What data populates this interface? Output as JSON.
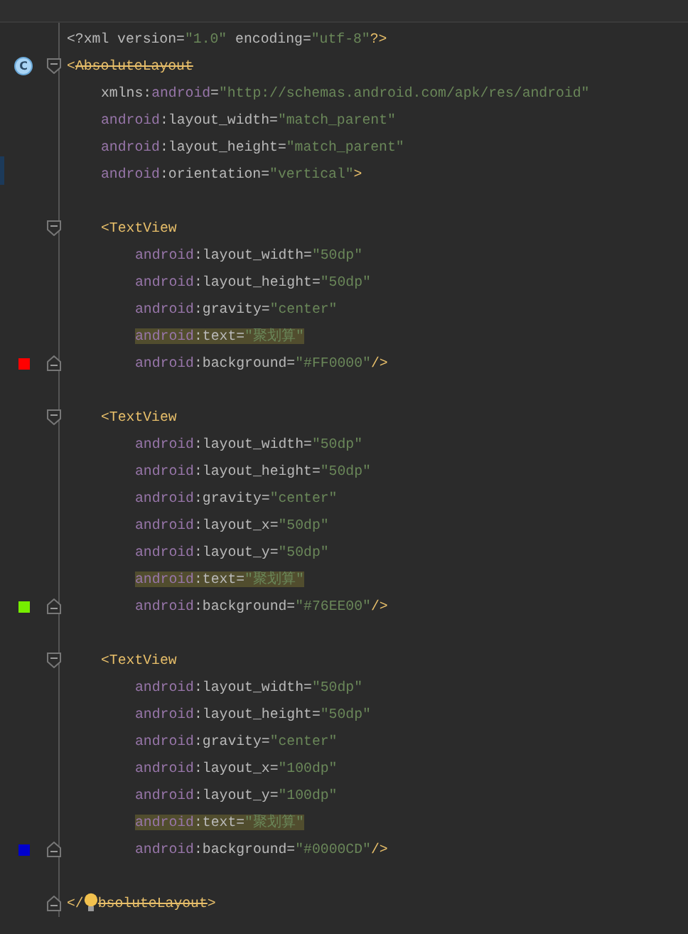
{
  "editor": {
    "lines": [
      {
        "kind": "code",
        "highlighted": false,
        "tokens": [
          {
            "kind": "plain",
            "text": "<?xml version="
          },
          {
            "kind": "value",
            "text": "\"1.0\""
          },
          {
            "kind": "plain",
            "text": " encoding="
          },
          {
            "kind": "value",
            "text": "\"utf-8\""
          },
          {
            "kind": "tag",
            "text": "?>"
          }
        ]
      },
      {
        "kind": "fold-start",
        "highlighted": false,
        "gutter_badge": "C",
        "tokens": [
          {
            "kind": "tag",
            "text": "<"
          },
          {
            "kind": "tag-deprecated",
            "text": "AbsoluteLayout"
          }
        ],
        "children": [
          {
            "kind": "code",
            "highlighted": false,
            "tokens": [
              {
                "kind": "plain",
                "text": "xmlns:"
              },
              {
                "kind": "ns",
                "text": "android"
              },
              {
                "kind": "plain",
                "text": "="
              },
              {
                "kind": "value",
                "text": "\"http://schemas.android.com/apk/res/android\""
              }
            ]
          },
          {
            "kind": "code",
            "highlighted": false,
            "tokens": [
              {
                "kind": "ns",
                "text": "android"
              },
              {
                "kind": "plain",
                "text": ":layout_width="
              },
              {
                "kind": "value",
                "text": "\"match_parent\""
              }
            ]
          },
          {
            "kind": "code",
            "highlighted": false,
            "tokens": [
              {
                "kind": "ns",
                "text": "android"
              },
              {
                "kind": "plain",
                "text": ":layout_height="
              },
              {
                "kind": "value",
                "text": "\"match_parent\""
              }
            ]
          },
          {
            "kind": "code",
            "highlighted": false,
            "tokens": [
              {
                "kind": "ns",
                "text": "android"
              },
              {
                "kind": "plain",
                "text": ":orientation="
              },
              {
                "kind": "value",
                "text": "\"vertical\""
              },
              {
                "kind": "tag",
                "text": ">"
              }
            ]
          },
          {
            "kind": "blank",
            "highlighted": false
          },
          {
            "kind": "fold-start",
            "highlighted": false,
            "tokens": [
              {
                "kind": "tag",
                "text": "<TextView"
              }
            ],
            "children": [
              {
                "kind": "code",
                "highlighted": false,
                "tokens": [
                  {
                    "kind": "ns",
                    "text": "android"
                  },
                  {
                    "kind": "plain",
                    "text": ":layout_width="
                  },
                  {
                    "kind": "value",
                    "text": "\"50dp\""
                  }
                ]
              },
              {
                "kind": "code",
                "highlighted": false,
                "tokens": [
                  {
                    "kind": "ns",
                    "text": "android"
                  },
                  {
                    "kind": "plain",
                    "text": ":layout_height="
                  },
                  {
                    "kind": "value",
                    "text": "\"50dp\""
                  }
                ]
              },
              {
                "kind": "code",
                "highlighted": false,
                "tokens": [
                  {
                    "kind": "ns",
                    "text": "android"
                  },
                  {
                    "kind": "plain",
                    "text": ":gravity="
                  },
                  {
                    "kind": "value",
                    "text": "\"center\""
                  }
                ]
              },
              {
                "kind": "code",
                "highlighted": true,
                "tokens": [
                  {
                    "kind": "ns",
                    "text": "android"
                  },
                  {
                    "kind": "plain",
                    "text": ":text="
                  },
                  {
                    "kind": "value",
                    "text": "\"聚划算\""
                  }
                ]
              },
              {
                "kind": "fold-end",
                "highlighted": false,
                "color": "#ff0000",
                "tokens": [
                  {
                    "kind": "ns",
                    "text": "android"
                  },
                  {
                    "kind": "plain",
                    "text": ":background="
                  },
                  {
                    "kind": "value",
                    "text": "\"#FF0000\""
                  },
                  {
                    "kind": "tag",
                    "text": "/>"
                  }
                ]
              }
            ]
          },
          {
            "kind": "blank",
            "highlighted": false
          },
          {
            "kind": "fold-start",
            "highlighted": false,
            "tokens": [
              {
                "kind": "tag",
                "text": "<TextView"
              }
            ],
            "children": [
              {
                "kind": "code",
                "highlighted": false,
                "tokens": [
                  {
                    "kind": "ns",
                    "text": "android"
                  },
                  {
                    "kind": "plain",
                    "text": ":layout_width="
                  },
                  {
                    "kind": "value",
                    "text": "\"50dp\""
                  }
                ]
              },
              {
                "kind": "code",
                "highlighted": false,
                "tokens": [
                  {
                    "kind": "ns",
                    "text": "android"
                  },
                  {
                    "kind": "plain",
                    "text": ":layout_height="
                  },
                  {
                    "kind": "value",
                    "text": "\"50dp\""
                  }
                ]
              },
              {
                "kind": "code",
                "highlighted": false,
                "tokens": [
                  {
                    "kind": "ns",
                    "text": "android"
                  },
                  {
                    "kind": "plain",
                    "text": ":gravity="
                  },
                  {
                    "kind": "value",
                    "text": "\"center\""
                  }
                ]
              },
              {
                "kind": "code",
                "highlighted": false,
                "tokens": [
                  {
                    "kind": "ns",
                    "text": "android"
                  },
                  {
                    "kind": "plain",
                    "text": ":layout_x="
                  },
                  {
                    "kind": "value",
                    "text": "\"50dp\""
                  }
                ]
              },
              {
                "kind": "code",
                "highlighted": false,
                "tokens": [
                  {
                    "kind": "ns",
                    "text": "android"
                  },
                  {
                    "kind": "plain",
                    "text": ":layout_y="
                  },
                  {
                    "kind": "value",
                    "text": "\"50dp\""
                  }
                ]
              },
              {
                "kind": "code",
                "highlighted": true,
                "tokens": [
                  {
                    "kind": "ns",
                    "text": "android"
                  },
                  {
                    "kind": "plain",
                    "text": ":text="
                  },
                  {
                    "kind": "value",
                    "text": "\"聚划算\""
                  }
                ]
              },
              {
                "kind": "fold-end",
                "highlighted": false,
                "color": "#76ee00",
                "tokens": [
                  {
                    "kind": "ns",
                    "text": "android"
                  },
                  {
                    "kind": "plain",
                    "text": ":background="
                  },
                  {
                    "kind": "value",
                    "text": "\"#76EE00\""
                  },
                  {
                    "kind": "tag",
                    "text": "/>"
                  }
                ]
              }
            ]
          },
          {
            "kind": "blank",
            "highlighted": false
          },
          {
            "kind": "fold-start",
            "highlighted": false,
            "tokens": [
              {
                "kind": "tag",
                "text": "<TextView"
              }
            ],
            "children": [
              {
                "kind": "code",
                "highlighted": false,
                "tokens": [
                  {
                    "kind": "ns",
                    "text": "android"
                  },
                  {
                    "kind": "plain",
                    "text": ":layout_width="
                  },
                  {
                    "kind": "value",
                    "text": "\"50dp\""
                  }
                ]
              },
              {
                "kind": "code",
                "highlighted": false,
                "tokens": [
                  {
                    "kind": "ns",
                    "text": "android"
                  },
                  {
                    "kind": "plain",
                    "text": ":layout_height="
                  },
                  {
                    "kind": "value",
                    "text": "\"50dp\""
                  }
                ]
              },
              {
                "kind": "code",
                "highlighted": false,
                "tokens": [
                  {
                    "kind": "ns",
                    "text": "android"
                  },
                  {
                    "kind": "plain",
                    "text": ":gravity="
                  },
                  {
                    "kind": "value",
                    "text": "\"center\""
                  }
                ]
              },
              {
                "kind": "code",
                "highlighted": false,
                "tokens": [
                  {
                    "kind": "ns",
                    "text": "android"
                  },
                  {
                    "kind": "plain",
                    "text": ":layout_x="
                  },
                  {
                    "kind": "value",
                    "text": "\"100dp\""
                  }
                ]
              },
              {
                "kind": "code",
                "highlighted": false,
                "tokens": [
                  {
                    "kind": "ns",
                    "text": "android"
                  },
                  {
                    "kind": "plain",
                    "text": ":layout_y="
                  },
                  {
                    "kind": "value",
                    "text": "\"100dp\""
                  }
                ]
              },
              {
                "kind": "code",
                "highlighted": true,
                "tokens": [
                  {
                    "kind": "ns",
                    "text": "android"
                  },
                  {
                    "kind": "plain",
                    "text": ":text="
                  },
                  {
                    "kind": "value",
                    "text": "\"聚划算\""
                  }
                ]
              },
              {
                "kind": "fold-end",
                "highlighted": false,
                "color": "#0000cd",
                "tokens": [
                  {
                    "kind": "ns",
                    "text": "android"
                  },
                  {
                    "kind": "plain",
                    "text": ":background="
                  },
                  {
                    "kind": "value",
                    "text": "\"#0000CD\""
                  },
                  {
                    "kind": "tag",
                    "text": "/>"
                  }
                ]
              }
            ]
          },
          {
            "kind": "blank",
            "highlighted": false
          }
        ]
      },
      {
        "kind": "fold-end",
        "highlighted": false,
        "intention": true,
        "tokens": [
          {
            "kind": "tag",
            "text": "</"
          },
          {
            "kind": "tag-deprecated",
            "text": "bsoluteLayout"
          },
          {
            "kind": "tag",
            "text": ">"
          }
        ]
      }
    ]
  }
}
